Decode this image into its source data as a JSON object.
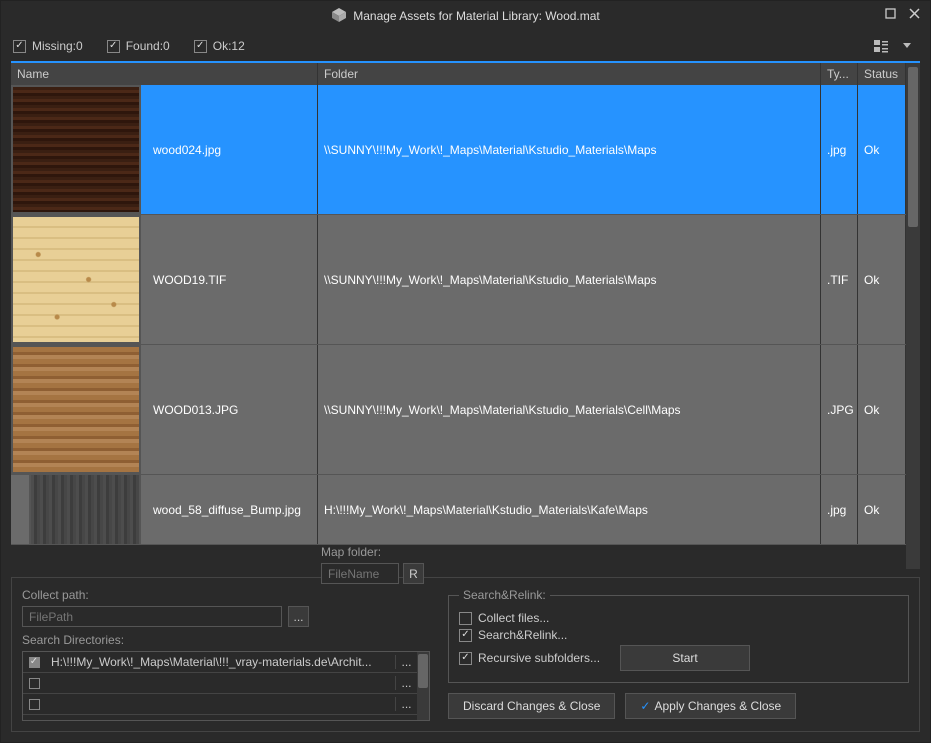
{
  "window": {
    "title": "Manage Assets  for Material Library: Wood.mat"
  },
  "filters": {
    "missing_label": "Missing:0",
    "found_label": "Found:0",
    "ok_label": "Ok:12"
  },
  "columns": {
    "name": "Name",
    "folder": "Folder",
    "type": "Ty...",
    "status": "Status"
  },
  "rows": [
    {
      "name": "wood024.jpg",
      "folder": "\\\\SUNNY\\!!!My_Work\\!_Maps\\Material\\Kstudio_Materials\\Maps",
      "type": ".jpg",
      "status": "Ok",
      "thumb": "wood-dark",
      "selected": true
    },
    {
      "name": "WOOD19.TIF",
      "folder": "\\\\SUNNY\\!!!My_Work\\!_Maps\\Material\\Kstudio_Materials\\Maps",
      "type": ".TIF",
      "status": "Ok",
      "thumb": "wood-pine",
      "selected": false
    },
    {
      "name": "WOOD013.JPG",
      "folder": "\\\\SUNNY\\!!!My_Work\\!_Maps\\Material\\Kstudio_Materials\\Cell\\Maps",
      "type": ".JPG",
      "status": "Ok",
      "thumb": "wood-oak",
      "selected": false
    },
    {
      "name": "wood_58_diffuse_Bump.jpg",
      "folder": "H:\\!!!My_Work\\!_Maps\\Material\\Kstudio_Materials\\Kafe\\Maps",
      "type": ".jpg",
      "status": "Ok",
      "thumb": "wood-grey",
      "selected": false
    }
  ],
  "collect": {
    "label": "Collect path:",
    "placeholder": "FilePath",
    "map_label": "Map folder:",
    "map_placeholder": "FileName",
    "r_btn": "R"
  },
  "search_dirs": {
    "label": "Search Directories:",
    "items": [
      {
        "checked": true,
        "path": "H:\\!!!My_Work\\!_Maps\\Material\\!!!_vray-materials.de\\Archit..."
      },
      {
        "checked": false,
        "path": ""
      },
      {
        "checked": false,
        "path": ""
      }
    ]
  },
  "search_relink": {
    "legend": "Search&Relink:",
    "collect": "Collect files...",
    "relink": "Search&Relink...",
    "recursive": "Recursive subfolders...",
    "start": "Start"
  },
  "buttons": {
    "discard": "Discard Changes & Close",
    "apply": "Apply Changes & Close"
  }
}
